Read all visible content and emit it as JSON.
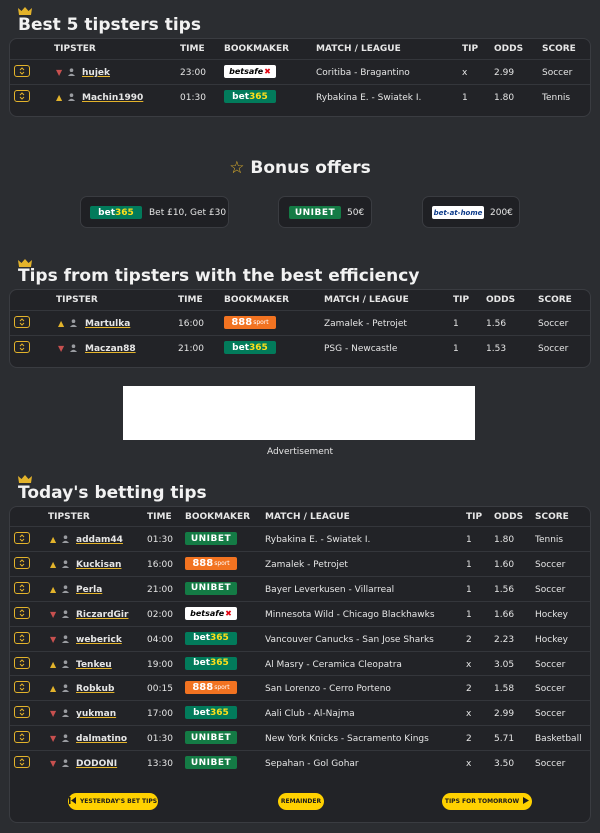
{
  "best5": {
    "title": "Best 5 tipsters tips",
    "headers": {
      "tipster": "TIPSTER",
      "time": "TIME",
      "bookmaker": "BOOKMAKER",
      "match": "MATCH / LEAGUE",
      "tip": "TIP",
      "odds": "ODDS",
      "score": "SCORE"
    },
    "rows": [
      {
        "trend": "down",
        "tipster": "hujek",
        "time": "23:00",
        "bookmaker": "betsafe",
        "match": "Coritiba - Bragantino",
        "tip": "x",
        "odds": "2.99",
        "score": "Soccer"
      },
      {
        "trend": "up",
        "tipster": "Machin1990",
        "time": "01:30",
        "bookmaker": "bet365",
        "match": "Rybakina E. - Swiatek I.",
        "tip": "1",
        "odds": "1.80",
        "score": "Tennis"
      }
    ]
  },
  "bonus": {
    "title": "Bonus offers",
    "offers": [
      {
        "bookmaker": "bet365",
        "text": "Bet £10, Get £30"
      },
      {
        "bookmaker": "unibet",
        "text": "50€"
      },
      {
        "bookmaker": "bet-at-home",
        "text": "200€"
      }
    ]
  },
  "efficiency": {
    "title": "Tips from tipsters with the best efficiency",
    "headers": {
      "tipster": "TIPSTER",
      "time": "TIME",
      "bookmaker": "BOOKMAKER",
      "match": "MATCH / LEAGUE",
      "tip": "TIP",
      "odds": "ODDS",
      "score": "SCORE"
    },
    "rows": [
      {
        "trend": "up",
        "tipster": "Martulka",
        "time": "16:00",
        "bookmaker": "888sport",
        "match": "Zamalek - Petrojet",
        "tip": "1",
        "odds": "1.56",
        "score": "Soccer"
      },
      {
        "trend": "down",
        "tipster": "Maczan88",
        "time": "21:00",
        "bookmaker": "bet365",
        "match": "PSG - Newcastle",
        "tip": "1",
        "odds": "1.53",
        "score": "Soccer"
      }
    ]
  },
  "ad": {
    "label": "Advertisement"
  },
  "today": {
    "title": "Today's betting tips",
    "headers": {
      "tipster": "TIPSTER",
      "time": "TIME",
      "bookmaker": "BOOKMAKER",
      "match": "MATCH / LEAGUE",
      "tip": "TIP",
      "odds": "ODDS",
      "score": "SCORE"
    },
    "rows": [
      {
        "trend": "up",
        "tipster": "addam44",
        "time": "01:30",
        "bookmaker": "unibet",
        "match": "Rybakina E. - Swiatek I.",
        "tip": "1",
        "odds": "1.80",
        "score": "Tennis"
      },
      {
        "trend": "up",
        "tipster": "Kuckisan",
        "time": "16:00",
        "bookmaker": "888sport",
        "match": "Zamalek - Petrojet",
        "tip": "1",
        "odds": "1.60",
        "score": "Soccer"
      },
      {
        "trend": "up",
        "tipster": "Perla",
        "time": "21:00",
        "bookmaker": "unibet",
        "match": "Bayer Leverkusen - Villarreal",
        "tip": "1",
        "odds": "1.56",
        "score": "Soccer"
      },
      {
        "trend": "down",
        "tipster": "RiczardGir",
        "time": "02:00",
        "bookmaker": "betsafe",
        "match": "Minnesota Wild - Chicago Blackhawks",
        "tip": "1",
        "odds": "1.66",
        "score": "Hockey"
      },
      {
        "trend": "down",
        "tipster": "weberick",
        "time": "04:00",
        "bookmaker": "bet365",
        "match": "Vancouver Canucks - San Jose Sharks",
        "tip": "2",
        "odds": "2.23",
        "score": "Hockey"
      },
      {
        "trend": "up",
        "tipster": "Tenkeu",
        "time": "19:00",
        "bookmaker": "bet365",
        "match": "Al Masry - Ceramica Cleopatra",
        "tip": "x",
        "odds": "3.05",
        "score": "Soccer"
      },
      {
        "trend": "up",
        "tipster": "Robkub",
        "time": "00:15",
        "bookmaker": "888sport",
        "match": "San Lorenzo - Cerro Porteno",
        "tip": "2",
        "odds": "1.58",
        "score": "Soccer"
      },
      {
        "trend": "down",
        "tipster": "yukman",
        "time": "17:00",
        "bookmaker": "bet365",
        "match": "Aali Club - Al-Najma",
        "tip": "x",
        "odds": "2.99",
        "score": "Soccer"
      },
      {
        "trend": "down",
        "tipster": "dalmatino",
        "time": "01:30",
        "bookmaker": "unibet",
        "match": "New York Knicks - Sacramento Kings",
        "tip": "2",
        "odds": "5.71",
        "score": "Basketball"
      },
      {
        "trend": "down",
        "tipster": "DODONI",
        "time": "13:30",
        "bookmaker": "unibet",
        "match": "Sepahan - Gol Gohar",
        "tip": "x",
        "odds": "3.50",
        "score": "Soccer"
      }
    ]
  },
  "nav": {
    "prev": "YESTERDAY'S BET TIPS",
    "mid": "REMAINDER",
    "next": "TIPS FOR TOMORROW"
  },
  "icons": {
    "crown": "crown-icon",
    "star": "star-icon",
    "expand": "expand-icon",
    "user": "user-icon",
    "trend_up": "trend-up-icon",
    "trend_down": "trend-down-icon"
  },
  "colors": {
    "accent": "#e3b32b",
    "button": "#ffd100",
    "background": "#2b2d31",
    "panel": "#222327",
    "trend_down": "#c8504f"
  }
}
